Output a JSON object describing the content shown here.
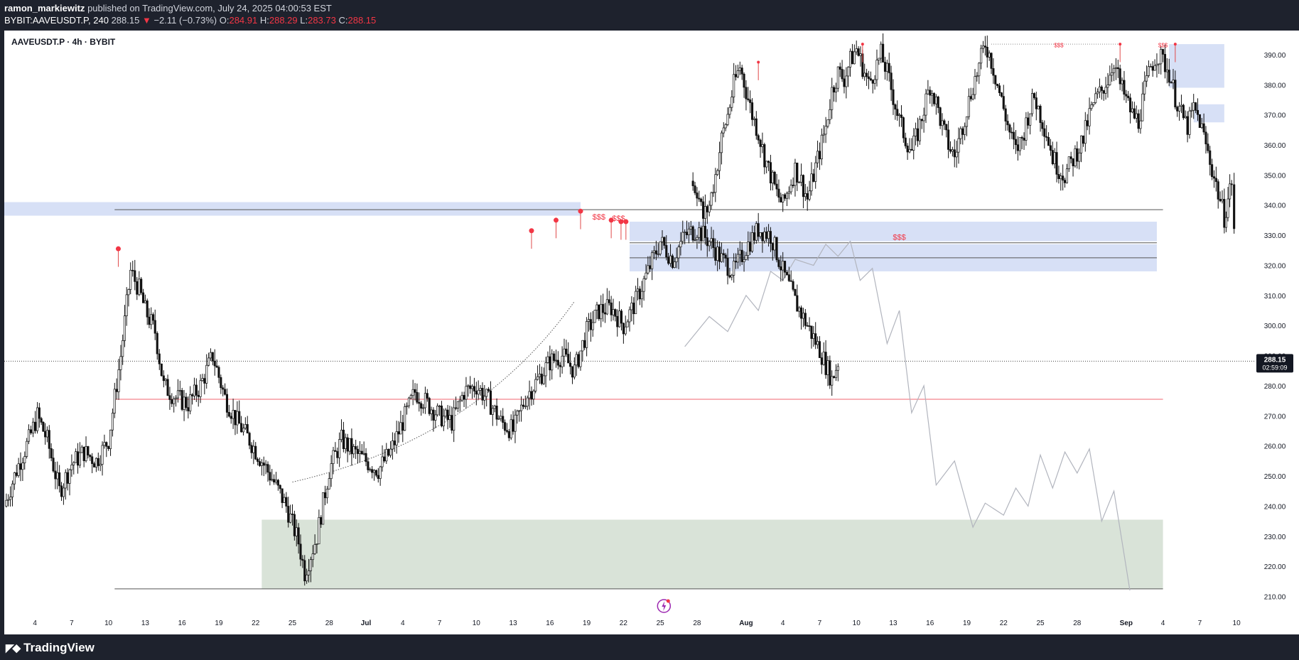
{
  "header": {
    "author": "ramon_markiewitz",
    "published_text": "published on TradingView.com, July 24, 2025 04:00:53 EST",
    "symbol_line": "BYBIT:AAVEUSDT.P, 240",
    "last": "288.15",
    "change": "−2.11 (−0.73%)",
    "open_label": "O:",
    "open": "284.91",
    "high_label": "H:",
    "high": "288.29",
    "low_label": "L:",
    "low": "283.73",
    "close_label": "C:",
    "close": "288.15"
  },
  "chart_title": "AAVEUSDT.P · 4h · BYBIT",
  "footer": {
    "logo_text": "TradingView"
  },
  "colors": {
    "down": "#f23645",
    "zone_blue": "#c9d6f3",
    "zone_green": "#d7e2d6",
    "background_dark": "#1e222d"
  },
  "chart_data": {
    "type": "candlestick",
    "title": "AAVEUSDT.P · 4h · BYBIT",
    "y_ticks": [
      "390.00",
      "380.00",
      "370.00",
      "360.00",
      "350.00",
      "340.00",
      "330.00",
      "320.00",
      "310.00",
      "300.00",
      "290.00",
      "280.00",
      "270.00",
      "260.00",
      "250.00",
      "240.00",
      "230.00",
      "220.00",
      "210.00"
    ],
    "ylim": [
      208,
      398
    ],
    "x_ticks": [
      "4",
      "7",
      "10",
      "13",
      "16",
      "19",
      "22",
      "25",
      "28",
      "Jul",
      "4",
      "7",
      "10",
      "13",
      "16",
      "19",
      "22",
      "25",
      "28",
      "Aug",
      "4",
      "7",
      "10",
      "13",
      "16",
      "19",
      "22",
      "25",
      "28",
      "Sep",
      "4",
      "7",
      "10"
    ],
    "x_tick_days": [
      4,
      7,
      10,
      13,
      16,
      19,
      22,
      25,
      28,
      31,
      34,
      37,
      40,
      43,
      46,
      49,
      52,
      55,
      58,
      62,
      65,
      68,
      71,
      74,
      77,
      80,
      83,
      86,
      89,
      93,
      96,
      99,
      102
    ],
    "xlim": [
      1.5,
      103.5
    ],
    "last_price": {
      "value": "288.15",
      "countdown": "02:59:09",
      "y": 288.15
    },
    "actual_price_path": [
      [
        1.5,
        240
      ],
      [
        2.5,
        252
      ],
      [
        3.5,
        262
      ],
      [
        4.2,
        270
      ],
      [
        5,
        262
      ],
      [
        6,
        245
      ],
      [
        7,
        254
      ],
      [
        8,
        258
      ],
      [
        9,
        255
      ],
      [
        10,
        262
      ],
      [
        11,
        290
      ],
      [
        11.8,
        318
      ],
      [
        12.5,
        312
      ],
      [
        13,
        305
      ],
      [
        13.8,
        298
      ],
      [
        14.5,
        280
      ],
      [
        15.5,
        276
      ],
      [
        16.5,
        274
      ],
      [
        17.5,
        280
      ],
      [
        18.5,
        290
      ],
      [
        19.5,
        276
      ],
      [
        20.5,
        268
      ],
      [
        21.5,
        262
      ],
      [
        22.5,
        255
      ],
      [
        23.5,
        248
      ],
      [
        24.5,
        240
      ],
      [
        25.5,
        228
      ],
      [
        26,
        218
      ],
      [
        27,
        230
      ],
      [
        28,
        252
      ],
      [
        29,
        262
      ],
      [
        30,
        258
      ],
      [
        31,
        255
      ],
      [
        32,
        252
      ],
      [
        33,
        258
      ],
      [
        34,
        268
      ],
      [
        35,
        278
      ],
      [
        36,
        274
      ],
      [
        37,
        270
      ],
      [
        38,
        268
      ],
      [
        39,
        278
      ],
      [
        40,
        280
      ],
      [
        41,
        275
      ],
      [
        42,
        268
      ],
      [
        43,
        265
      ],
      [
        44,
        276
      ],
      [
        45,
        282
      ],
      [
        46,
        288
      ],
      [
        47,
        290
      ],
      [
        48,
        285
      ],
      [
        49,
        298
      ],
      [
        50,
        305
      ],
      [
        51,
        306
      ],
      [
        52,
        300
      ],
      [
        53,
        308
      ],
      [
        54,
        318
      ],
      [
        55,
        328
      ],
      [
        56,
        322
      ],
      [
        57,
        330
      ],
      [
        58,
        332
      ],
      [
        59,
        328
      ],
      [
        60,
        322
      ],
      [
        61,
        318
      ],
      [
        62,
        326
      ],
      [
        63,
        332
      ],
      [
        64,
        330
      ],
      [
        65,
        318
      ],
      [
        66,
        308
      ],
      [
        67,
        300
      ],
      [
        68,
        292
      ],
      [
        69,
        282
      ],
      [
        69.5,
        288
      ]
    ],
    "candle_segments": [
      {
        "from": [
          1.5,
          240
        ],
        "to": [
          69.5,
          288
        ]
      },
      {
        "from": [
          57.5,
          348
        ],
        "to": [
          101.8,
          330
        ]
      }
    ],
    "future_path_upper": [
      [
        57.5,
        348
      ],
      [
        58,
        345
      ],
      [
        58.5,
        336
      ],
      [
        59,
        340
      ],
      [
        59.5,
        350
      ],
      [
        60,
        362
      ],
      [
        60.5,
        370
      ],
      [
        61,
        380
      ],
      [
        61.5,
        386
      ],
      [
        62,
        378
      ],
      [
        62.5,
        370
      ],
      [
        63,
        364
      ],
      [
        63.5,
        356
      ],
      [
        64,
        350
      ],
      [
        64.5,
        344
      ],
      [
        65,
        340
      ],
      [
        65.5,
        346
      ],
      [
        66,
        352
      ],
      [
        66.5,
        348
      ],
      [
        67,
        342
      ],
      [
        67.5,
        350
      ],
      [
        68,
        358
      ],
      [
        68.5,
        366
      ],
      [
        69,
        378
      ],
      [
        69.5,
        384
      ],
      [
        70,
        382
      ],
      [
        70.5,
        388
      ],
      [
        71,
        392
      ],
      [
        71.5,
        386
      ],
      [
        72,
        380
      ],
      [
        72.5,
        385
      ],
      [
        73,
        390
      ],
      [
        73.5,
        384
      ],
      [
        74,
        376
      ],
      [
        74.5,
        368
      ],
      [
        75,
        362
      ],
      [
        75.5,
        358
      ],
      [
        76,
        364
      ],
      [
        76.5,
        372
      ],
      [
        77,
        380
      ],
      [
        77.5,
        374
      ],
      [
        78,
        366
      ],
      [
        78.5,
        360
      ],
      [
        79,
        356
      ],
      [
        79.5,
        364
      ],
      [
        80,
        372
      ],
      [
        80.5,
        380
      ],
      [
        81,
        386
      ],
      [
        81.5,
        394
      ],
      [
        82,
        388
      ],
      [
        82.5,
        380
      ],
      [
        83,
        372
      ],
      [
        83.5,
        364
      ],
      [
        84,
        358
      ],
      [
        84.5,
        362
      ],
      [
        85,
        370
      ],
      [
        85.5,
        376
      ],
      [
        86,
        370
      ],
      [
        86.5,
        364
      ],
      [
        87,
        356
      ],
      [
        87.5,
        352
      ],
      [
        88,
        350
      ],
      [
        88.5,
        354
      ],
      [
        89,
        358
      ],
      [
        89.5,
        362
      ],
      [
        90,
        370
      ],
      [
        90.5,
        375
      ],
      [
        91,
        378
      ],
      [
        91.5,
        382
      ],
      [
        92,
        388
      ],
      [
        92.5,
        380
      ],
      [
        93,
        375
      ],
      [
        93.5,
        370
      ],
      [
        94,
        368
      ],
      [
        94.5,
        378
      ],
      [
        95,
        386
      ],
      [
        95.5,
        390
      ],
      [
        96,
        388
      ],
      [
        96.5,
        384
      ],
      [
        97,
        376
      ],
      [
        97.5,
        370
      ],
      [
        98,
        366
      ],
      [
        98.5,
        372
      ],
      [
        99,
        368
      ],
      [
        99.5,
        360
      ],
      [
        100,
        352
      ],
      [
        100.5,
        344
      ],
      [
        101,
        336
      ],
      [
        101.3,
        342
      ],
      [
        101.6,
        348
      ],
      [
        101.8,
        332
      ]
    ],
    "projection_path": [
      [
        57,
        293
      ],
      [
        59,
        303
      ],
      [
        60.5,
        298
      ],
      [
        62,
        310
      ],
      [
        63,
        305
      ],
      [
        64,
        318
      ],
      [
        65,
        315
      ],
      [
        66,
        322
      ],
      [
        67.5,
        320
      ],
      [
        68.5,
        327
      ],
      [
        69.5,
        323
      ],
      [
        70.5,
        328
      ],
      [
        71.3,
        315
      ],
      [
        72.3,
        319
      ],
      [
        73.5,
        294
      ],
      [
        74.5,
        305
      ],
      [
        75.5,
        271
      ],
      [
        76.5,
        280
      ],
      [
        77.5,
        247
      ],
      [
        79,
        255
      ],
      [
        80.5,
        233
      ],
      [
        81.5,
        241
      ],
      [
        83,
        237
      ],
      [
        84,
        246
      ],
      [
        85,
        240
      ],
      [
        86,
        257
      ],
      [
        87,
        246
      ],
      [
        88,
        258
      ],
      [
        89,
        251
      ],
      [
        90,
        259
      ],
      [
        91,
        235
      ],
      [
        92,
        245
      ],
      [
        93.3,
        212
      ]
    ],
    "swing_arc": {
      "from": [
        25,
        248
      ],
      "via": [
        40,
        262
      ],
      "to": [
        48,
        308
      ]
    },
    "zones": [
      {
        "kind": "supply",
        "x0": 1.5,
        "x1": 48.5,
        "y0": 336.5,
        "y1": 341.0
      },
      {
        "kind": "supply",
        "x0": 52.5,
        "x1": 95.5,
        "y0": 328.0,
        "y1": 334.5
      },
      {
        "kind": "supply",
        "x0": 52.5,
        "x1": 95.5,
        "y0": 318.0,
        "y1": 327.0
      },
      {
        "kind": "supply",
        "x0": 96.5,
        "x1": 101.0,
        "y0": 379.0,
        "y1": 393.5
      },
      {
        "kind": "supply",
        "x0": 98.5,
        "x1": 101.0,
        "y0": 367.5,
        "y1": 373.5
      },
      {
        "kind": "demand",
        "x0": 22.5,
        "x1": 96.0,
        "y0": 212.5,
        "y1": 235.5
      }
    ],
    "hlines": [
      {
        "kind": "dark",
        "x0": 10.5,
        "x1": 96.0,
        "y": 338.5
      },
      {
        "kind": "red",
        "x0": 10.5,
        "x1": 96.0,
        "y": 275.5
      },
      {
        "kind": "dark",
        "x0": 10.5,
        "x1": 96.0,
        "y": 212.5
      },
      {
        "kind": "dark",
        "x0": 52.5,
        "x1": 95.5,
        "y": 327.5
      },
      {
        "kind": "dark",
        "x0": 52.5,
        "x1": 95.5,
        "y": 322.5
      },
      {
        "kind": "dotted",
        "x0": 82,
        "x1": 92.5,
        "y": 393.5
      }
    ],
    "swing_highs": [
      [
        10.8,
        325.5
      ],
      [
        44.5,
        331.5
      ],
      [
        46.5,
        335
      ],
      [
        48.5,
        338
      ],
      [
        51,
        335
      ],
      [
        51.8,
        334.5
      ],
      [
        52.2,
        334.5
      ],
      [
        63,
        387.5
      ],
      [
        71.5,
        393.5
      ],
      [
        92.5,
        393.5
      ],
      [
        97,
        393.5
      ]
    ],
    "annotations": [
      {
        "text": "$$$",
        "x": 50.0,
        "y": 335.2
      },
      {
        "text": "$$$",
        "x": 51.6,
        "y": 334.8
      },
      {
        "text": "$$$",
        "x": 74.5,
        "y": 328.5
      },
      {
        "text": "$$$",
        "x": 87.5,
        "y": 392.5
      },
      {
        "text": "$$$",
        "x": 96.0,
        "y": 392.5
      }
    ]
  }
}
